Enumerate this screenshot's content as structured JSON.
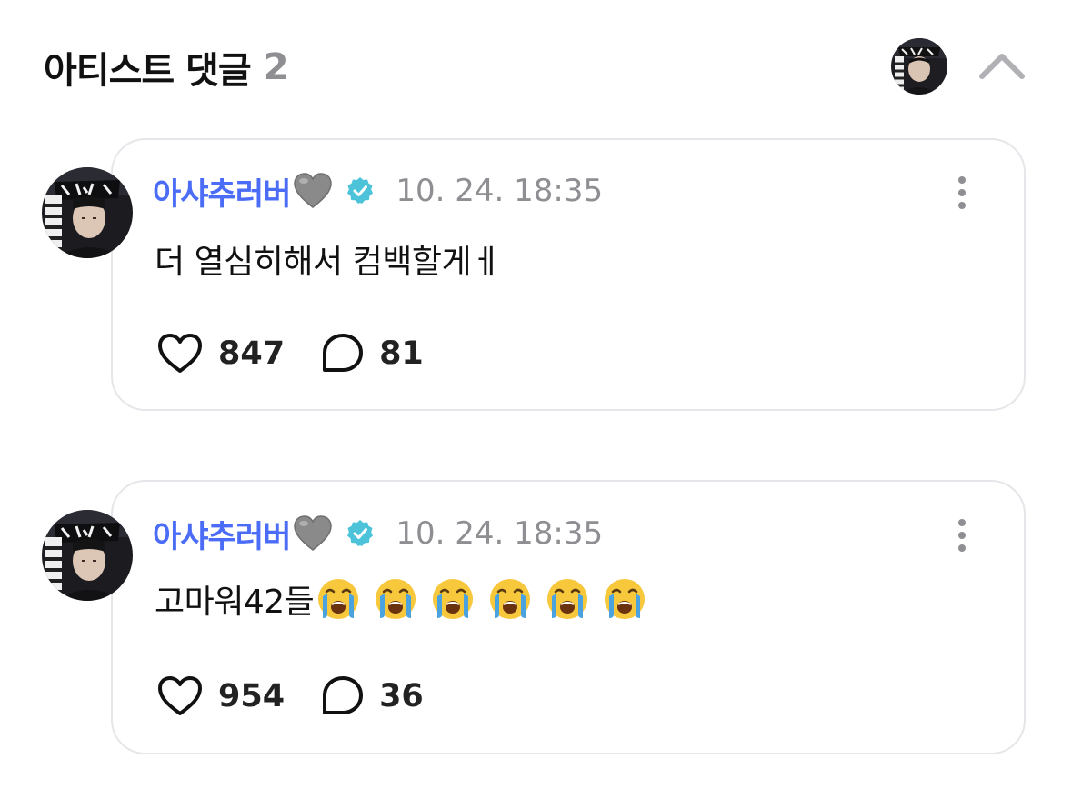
{
  "header": {
    "title": "아티스트 댓글",
    "count": "2"
  },
  "comments": [
    {
      "author": "아샤추러버",
      "timestamp": "10. 24. 18:35",
      "text": "더 열심히해서 컴백할게ㅔ",
      "likes": "847",
      "replies": "81",
      "emojis": []
    },
    {
      "author": "아샤추러버",
      "timestamp": "10. 24. 18:35",
      "text": "고마워42들",
      "likes": "954",
      "replies": "36",
      "emojis": [
        "crying-face",
        "crying-face",
        "crying-face",
        "crying-face",
        "crying-face",
        "crying-face"
      ]
    }
  ],
  "colors": {
    "author_name": "#4a6cf7",
    "verified_badge": "#4cc3d9",
    "timestamp": "#8e8e93",
    "count": "#8e8e93",
    "card_border": "#e6e6ea",
    "emoji_face": "#f7c73c",
    "emoji_tears": "#4aa3df",
    "grey_heart": "#8a8a8a"
  }
}
